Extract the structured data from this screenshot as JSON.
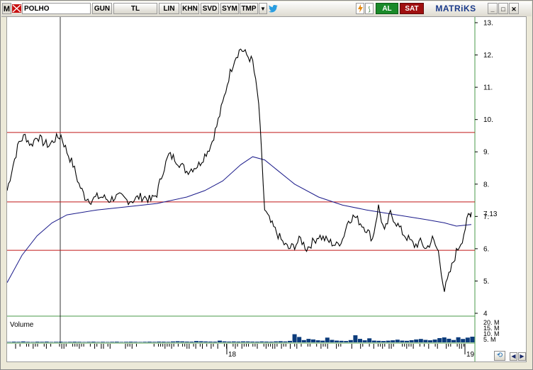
{
  "toolbar": {
    "menu_letter": "M",
    "symbol": "POLHO",
    "buttons": [
      "GUN",
      "TL",
      "LIN",
      "KHN",
      "SVD",
      "SYM",
      "TMP"
    ],
    "buy_label": "AL",
    "sell_label": "SAT",
    "brand": "MATRiKS",
    "window_controls": [
      "minimize",
      "maximize",
      "close"
    ],
    "colors": {
      "buy": "#1a8a2a",
      "sell": "#a01010",
      "brand": "#1a3a8a"
    }
  },
  "chart": {
    "y_axis_labels": [
      "13.",
      "12.",
      "11.",
      "10.",
      "9.",
      "8.",
      "7.",
      "6.",
      "5.",
      "4"
    ],
    "last_price_label": "7.13",
    "x_axis_labels": [
      "18",
      "19"
    ],
    "volume_label": "Volume",
    "volume_axis_labels": [
      "20. M",
      "15. M",
      "10. M",
      "5. M"
    ],
    "colors": {
      "price": "#000000",
      "moving_average": "#1a1a8a",
      "support_lines": "#c01818",
      "volume": "#0c3c7c"
    }
  },
  "chart_data": {
    "type": "line",
    "y_ticks": [
      13,
      12,
      11,
      10,
      9,
      8,
      7,
      6,
      5,
      4
    ],
    "ylim": [
      4,
      13.2
    ],
    "last_value": 7.13,
    "horizontal_lines": [
      9.6,
      7.45,
      5.95
    ],
    "price_series": [
      [
        0,
        7.8
      ],
      [
        2,
        8.6
      ],
      [
        4,
        9.3
      ],
      [
        6,
        9.5
      ],
      [
        8,
        9.2
      ],
      [
        10,
        9.5
      ],
      [
        12,
        9.3
      ],
      [
        14,
        9.2
      ],
      [
        16,
        9.4
      ],
      [
        18,
        9.5
      ],
      [
        20,
        9.0
      ],
      [
        22,
        8.6
      ],
      [
        24,
        8.0
      ],
      [
        26,
        7.6
      ],
      [
        28,
        7.5
      ],
      [
        30,
        7.6
      ],
      [
        32,
        7.6
      ],
      [
        34,
        7.5
      ],
      [
        36,
        7.6
      ],
      [
        38,
        7.6
      ],
      [
        40,
        7.5
      ],
      [
        42,
        7.5
      ],
      [
        44,
        7.6
      ],
      [
        46,
        7.6
      ],
      [
        48,
        7.5
      ],
      [
        50,
        7.7
      ],
      [
        52,
        8.4
      ],
      [
        54,
        8.9
      ],
      [
        56,
        8.8
      ],
      [
        58,
        8.6
      ],
      [
        60,
        8.4
      ],
      [
        62,
        8.5
      ],
      [
        64,
        8.6
      ],
      [
        66,
        8.9
      ],
      [
        68,
        9.2
      ],
      [
        70,
        9.8
      ],
      [
        72,
        10.5
      ],
      [
        74,
        11.3
      ],
      [
        76,
        11.9
      ],
      [
        78,
        12.2
      ],
      [
        80,
        12.0
      ],
      [
        82,
        11.8
      ],
      [
        84,
        10.5
      ],
      [
        86,
        7.2
      ],
      [
        88,
        6.8
      ],
      [
        90,
        6.5
      ],
      [
        92,
        6.2
      ],
      [
        94,
        6.0
      ],
      [
        96,
        6.1
      ],
      [
        98,
        6.3
      ],
      [
        100,
        6.0
      ],
      [
        102,
        6.2
      ],
      [
        104,
        6.4
      ],
      [
        106,
        6.3
      ],
      [
        108,
        6.2
      ],
      [
        110,
        6.1
      ],
      [
        112,
        6.3
      ],
      [
        114,
        6.9
      ],
      [
        116,
        7.0
      ],
      [
        118,
        6.8
      ],
      [
        120,
        6.6
      ],
      [
        122,
        6.3
      ],
      [
        124,
        7.3
      ],
      [
        126,
        6.5
      ],
      [
        128,
        7.1
      ],
      [
        130,
        6.8
      ],
      [
        132,
        6.5
      ],
      [
        134,
        6.3
      ],
      [
        136,
        6.1
      ],
      [
        138,
        6.2
      ],
      [
        140,
        6.0
      ],
      [
        142,
        6.3
      ],
      [
        144,
        5.9
      ],
      [
        146,
        4.7
      ],
      [
        148,
        5.3
      ],
      [
        150,
        5.9
      ],
      [
        152,
        6.3
      ],
      [
        154,
        7.0
      ],
      [
        155,
        7.13
      ]
    ],
    "moving_average_series": [
      [
        0,
        4.95
      ],
      [
        5,
        5.8
      ],
      [
        10,
        6.4
      ],
      [
        15,
        6.8
      ],
      [
        20,
        7.05
      ],
      [
        30,
        7.2
      ],
      [
        40,
        7.3
      ],
      [
        50,
        7.4
      ],
      [
        60,
        7.6
      ],
      [
        66,
        7.8
      ],
      [
        72,
        8.1
      ],
      [
        78,
        8.6
      ],
      [
        82,
        8.85
      ],
      [
        86,
        8.75
      ],
      [
        90,
        8.45
      ],
      [
        96,
        8.0
      ],
      [
        104,
        7.6
      ],
      [
        112,
        7.35
      ],
      [
        120,
        7.2
      ],
      [
        130,
        7.05
      ],
      [
        140,
        6.9
      ],
      [
        146,
        6.8
      ],
      [
        150,
        6.7
      ],
      [
        155,
        6.75
      ]
    ],
    "volume_series": [
      0.4,
      0.6,
      0.5,
      0.8,
      0.5,
      0.4,
      0.6,
      0.5,
      0.7,
      0.4,
      0.5,
      0.6,
      0.4,
      0.5,
      0.6,
      0.5,
      0.4,
      0.5,
      0.6,
      0.4,
      0.5,
      0.4,
      0.5,
      0.6,
      0.4,
      0.5,
      0.6,
      0.5,
      0.4,
      0.5,
      0.6,
      0.5,
      0.7,
      0.6,
      0.5,
      0.8,
      1.0,
      0.9,
      0.7,
      0.6,
      1.2,
      1.0,
      0.8,
      0.7,
      0.6,
      1.5,
      0.9,
      0.7,
      0.8,
      0.7,
      0.9,
      0.8,
      0.7,
      0.6,
      0.8,
      0.7,
      0.6,
      0.9,
      1.1,
      0.8,
      1.3,
      7.2,
      4.8,
      2.0,
      3.1,
      2.6,
      1.8,
      1.5,
      4.2,
      2.2,
      1.6,
      1.4,
      1.2,
      2.0,
      6.3,
      3.1,
      1.8,
      3.6,
      1.6,
      1.4,
      1.2,
      1.5,
      1.8,
      2.4,
      1.6,
      1.4,
      1.9,
      2.6,
      3.0,
      2.2,
      1.8,
      2.5,
      3.8,
      4.4,
      3.2,
      2.1,
      4.5,
      3.0,
      4.2,
      5.0
    ],
    "volume_ylim": [
      0,
      22
    ]
  }
}
